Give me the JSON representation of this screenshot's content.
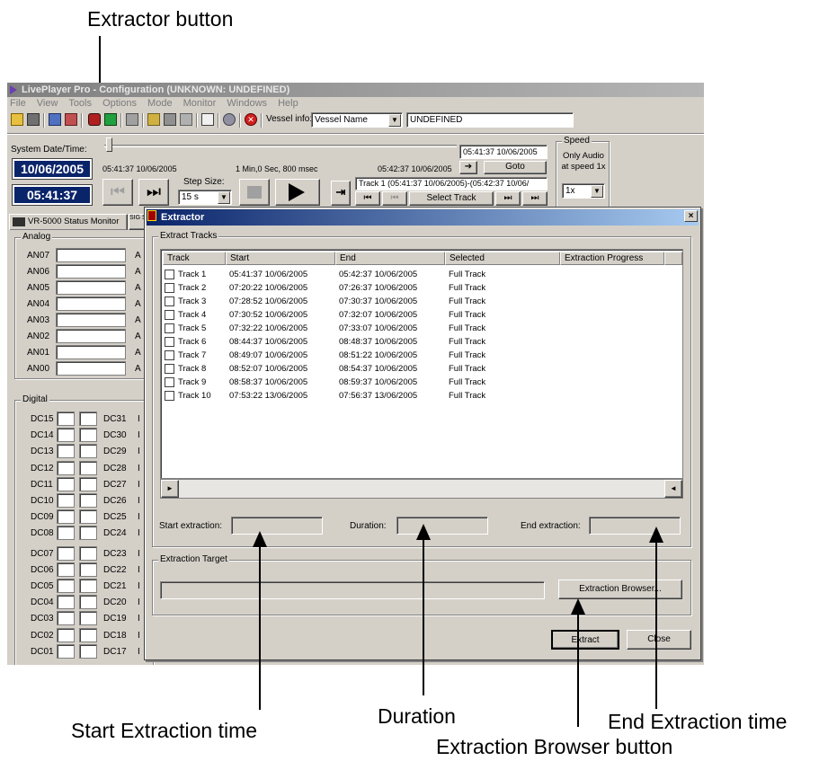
{
  "annotations": {
    "extractor_button": "Extractor button",
    "start_extraction_time": "Start Extraction time",
    "duration": "Duration",
    "end_extraction_time": "End Extraction time",
    "extraction_browser_button": "Extraction Browser button"
  },
  "app": {
    "title": "LivePlayer Pro - Configuration (UNKNOWN: UNDEFINED)",
    "menu": [
      "File",
      "View",
      "Tools",
      "Options",
      "Mode",
      "Monitor",
      "Windows",
      "Help"
    ],
    "vessel_info_label": "Vessel info:",
    "vessel_name_select": "Vessel Name",
    "vessel_value": "UNDEFINED",
    "system_datetime_label": "System Date/Time:",
    "system_date": "10/06/2005",
    "system_time": "05:41:37",
    "range_start": "05:41:37 10/06/2005",
    "range_mid": "1 Min,0 Sec, 800 msec",
    "range_end": "05:42:37 10/06/2005",
    "goto_time": "05:41:37 10/06/2005",
    "goto_label": "Goto",
    "step_size_label": "Step Size:",
    "step_size_value": "15 s",
    "track_selector_text": "Track 1 (05:41:37 10/06/2005)-(05:42:37 10/06/",
    "select_track_label": "Select Track",
    "speed_group_label": "Speed",
    "speed_note": "Only Audio at speed 1x",
    "speed_value": "1x",
    "tab_status_monitor": "VR-5000 Status Monitor",
    "tab_sig": "SIG SIM",
    "analog_group": "Analog",
    "analog_channels": [
      "AN07",
      "AN06",
      "AN05",
      "AN04",
      "AN03",
      "AN02",
      "AN01",
      "AN00"
    ],
    "analog_right_letter": "A",
    "digital_group": "Digital",
    "digital_left": [
      "DC15",
      "DC14",
      "DC13",
      "DC12",
      "DC11",
      "DC10",
      "DC09",
      "DC08",
      "DC07",
      "DC06",
      "DC05",
      "DC04",
      "DC03",
      "DC02",
      "DC01"
    ],
    "digital_right": [
      "DC31",
      "DC30",
      "DC29",
      "DC28",
      "DC27",
      "DC26",
      "DC25",
      "DC24",
      "DC23",
      "DC22",
      "DC21",
      "DC20",
      "DC19",
      "DC18",
      "DC17"
    ]
  },
  "dialog": {
    "title": "Extractor",
    "close_glyph": "×",
    "extract_tracks_group": "Extract Tracks",
    "columns": [
      "Track",
      "Start",
      "End",
      "Selected",
      "Extraction Progress"
    ],
    "tracks": [
      {
        "track": "Track 1",
        "start": "05:41:37 10/06/2005",
        "end": "05:42:37 10/06/2005",
        "selected": "Full Track"
      },
      {
        "track": "Track 2",
        "start": "07:20:22 10/06/2005",
        "end": "07:26:37 10/06/2005",
        "selected": "Full Track"
      },
      {
        "track": "Track 3",
        "start": "07:28:52 10/06/2005",
        "end": "07:30:37 10/06/2005",
        "selected": "Full Track"
      },
      {
        "track": "Track 4",
        "start": "07:30:52 10/06/2005",
        "end": "07:32:07 10/06/2005",
        "selected": "Full Track"
      },
      {
        "track": "Track 5",
        "start": "07:32:22 10/06/2005",
        "end": "07:33:07 10/06/2005",
        "selected": "Full Track"
      },
      {
        "track": "Track 6",
        "start": "08:44:37 10/06/2005",
        "end": "08:48:37 10/06/2005",
        "selected": "Full Track"
      },
      {
        "track": "Track 7",
        "start": "08:49:07 10/06/2005",
        "end": "08:51:22 10/06/2005",
        "selected": "Full Track"
      },
      {
        "track": "Track 8",
        "start": "08:52:07 10/06/2005",
        "end": "08:54:37 10/06/2005",
        "selected": "Full Track"
      },
      {
        "track": "Track 9",
        "start": "08:58:37 10/06/2005",
        "end": "08:59:37 10/06/2005",
        "selected": "Full Track"
      },
      {
        "track": "Track 10",
        "start": "07:53:22 13/06/2005",
        "end": "07:56:37 13/06/2005",
        "selected": "Full Track"
      }
    ],
    "start_extraction_label": "Start extraction:",
    "start_extraction_value": "",
    "duration_label": "Duration:",
    "duration_value": "",
    "end_extraction_label": "End extraction:",
    "end_extraction_value": "",
    "extraction_target_group": "Extraction Target",
    "extraction_target_value": "",
    "extraction_browser_label": "Extraction Browser...",
    "extract_label": "Extract",
    "close_label": "Close"
  }
}
